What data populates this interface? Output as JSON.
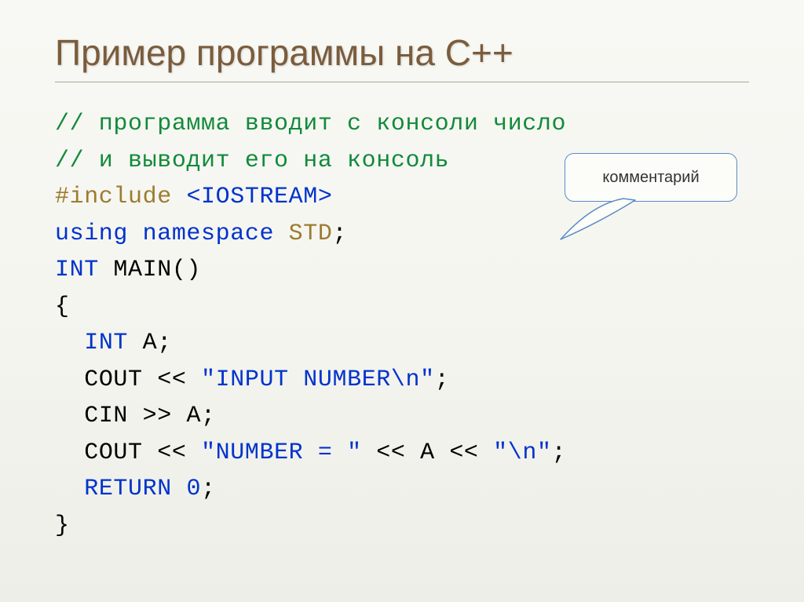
{
  "title": "Пример программы на C++",
  "callout": {
    "label": "комментарий"
  },
  "code": {
    "line1_comment": "// программа вводит с консоли число",
    "line2_comment": "// и выводит его на консоль",
    "include_kw": "#include",
    "include_target": "<IOSTREAM>",
    "using_kw": "using",
    "namespace_kw": "namespace",
    "std": "STD",
    "semicolon": ";",
    "int_kw": "INT",
    "main_fn": "MAIN",
    "parens": "()",
    "lbrace": "{",
    "var_decl_type": "INT",
    "var_decl_name": " A;",
    "cout1_a": "COUT",
    "cout1_b": " << ",
    "cout1_str": "\"INPUT NUMBER\\n\"",
    "cout1_end": ";",
    "cin_a": "CIN",
    "cin_b": " >> A;",
    "cout2_a": "COUT",
    "cout2_b": " << ",
    "cout2_str1": "\"NUMBER = \"",
    "cout2_c": " << A << ",
    "cout2_str2": "\"\\n\"",
    "cout2_end": ";",
    "return_kw": "RETURN",
    "return_val": " 0",
    "return_end": ";",
    "rbrace": "}"
  }
}
